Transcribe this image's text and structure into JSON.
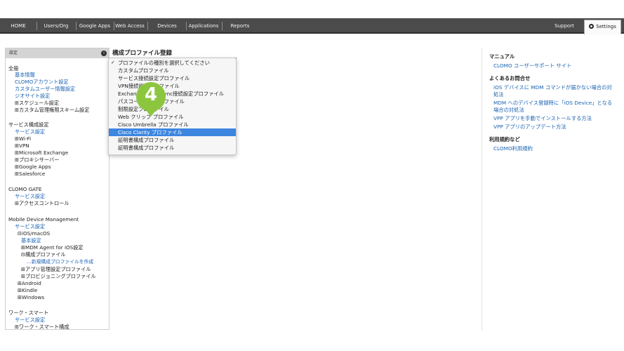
{
  "nav_tabs": [
    {
      "label": "HOME"
    },
    {
      "label": "Users/Org"
    },
    {
      "label": "Google Apps"
    },
    {
      "label": "Web Access"
    },
    {
      "label": "Devices"
    },
    {
      "label": "Applications"
    },
    {
      "label": "Reports"
    },
    {
      "label": "Support"
    }
  ],
  "settings_tab": "Settings",
  "sidebar": {
    "header": "設定",
    "items": [
      {
        "label": "全般"
      },
      {
        "label": "基本情報"
      },
      {
        "label": "CLOMOアカウント設定"
      },
      {
        "label": "カスタムユーザー情報設定"
      },
      {
        "label": "ジオサイト設定"
      },
      {
        "label": "⊞スケジュール設定"
      },
      {
        "label": "⊞カスタム管理権限スキーム設定"
      },
      {
        "label": "サービス構成設定"
      },
      {
        "label": "サービス設定"
      },
      {
        "label": "⊞Wi-Fi"
      },
      {
        "label": "⊞VPN"
      },
      {
        "label": "⊞Microsoft Exchange"
      },
      {
        "label": "⊞プロキシサーバー"
      },
      {
        "label": "⊞Google Apps"
      },
      {
        "label": "⊞Salesforce"
      },
      {
        "label": "CLOMO GATE"
      },
      {
        "label": "サービス設定"
      },
      {
        "label": "⊞アクセスコントロール"
      },
      {
        "label": "Mobile Device Management"
      },
      {
        "label": "サービス設定"
      },
      {
        "label": "⊟iOS/macOS"
      },
      {
        "label": "基本設定"
      },
      {
        "label": "⊞MDM Agent for iOS設定"
      },
      {
        "label": "⊟構成プロファイル"
      },
      {
        "label": "…新規構成プロファイルを作成"
      },
      {
        "label": "⊞アプリ管理設定プロファイル"
      },
      {
        "label": "⊞プロビジョニングプロファイル"
      },
      {
        "label": "⊞Android"
      },
      {
        "label": "⊞Kindle"
      },
      {
        "label": "⊞Windows"
      },
      {
        "label": "ワーク・スマート"
      },
      {
        "label": "サービス設定"
      },
      {
        "label": "⊞ワーク・スマート構成"
      }
    ]
  },
  "main": {
    "title": "構成プロファイル登録",
    "dropdown_options": [
      {
        "label": "プロファイルの種別を選択してください"
      },
      {
        "label": "カスタムプロファイル"
      },
      {
        "label": "サービス接続設定プロファイル"
      },
      {
        "label": "VPN接続設定プロファイル"
      },
      {
        "label": "Exchange ActiveSync接続設定プロファイル"
      },
      {
        "label": "パスコード設定プロファイル"
      },
      {
        "label": "制限設定プロファイル"
      },
      {
        "label": "Web クリップ プロファイル"
      },
      {
        "label": "Cisco Umbrella プロファイル"
      },
      {
        "label": "Cisco Clarity プロファイル"
      },
      {
        "label": "証明書構成プロファイル"
      },
      {
        "label": "証明書構成プロファイル"
      }
    ],
    "step_marker": "4"
  },
  "right_panel": {
    "manual_heading": "マニュアル",
    "manual_link": "CLOMO ユーザーサポート サイト",
    "faq_heading": "よくあるお問合せ",
    "faq_links": [
      {
        "label": "iOS デバイスに MDM コマンドが届かない場合の対"
      },
      {
        "label": "処法"
      },
      {
        "label": "MDM へのデバイス登録時に「iOS Device」となる"
      },
      {
        "label": "場合の対処法"
      },
      {
        "label": "VPP アプリを手動でインストールする方法"
      },
      {
        "label": "VPP アプリのアップデート方法"
      }
    ],
    "terms_heading": "利用規約など",
    "terms_link": "CLOMO利用規約"
  },
  "colors": {
    "topbar": "#4b4b4b",
    "link": "#1a62b3",
    "selection": "#3d86e0",
    "marker": "#8cc63f"
  }
}
